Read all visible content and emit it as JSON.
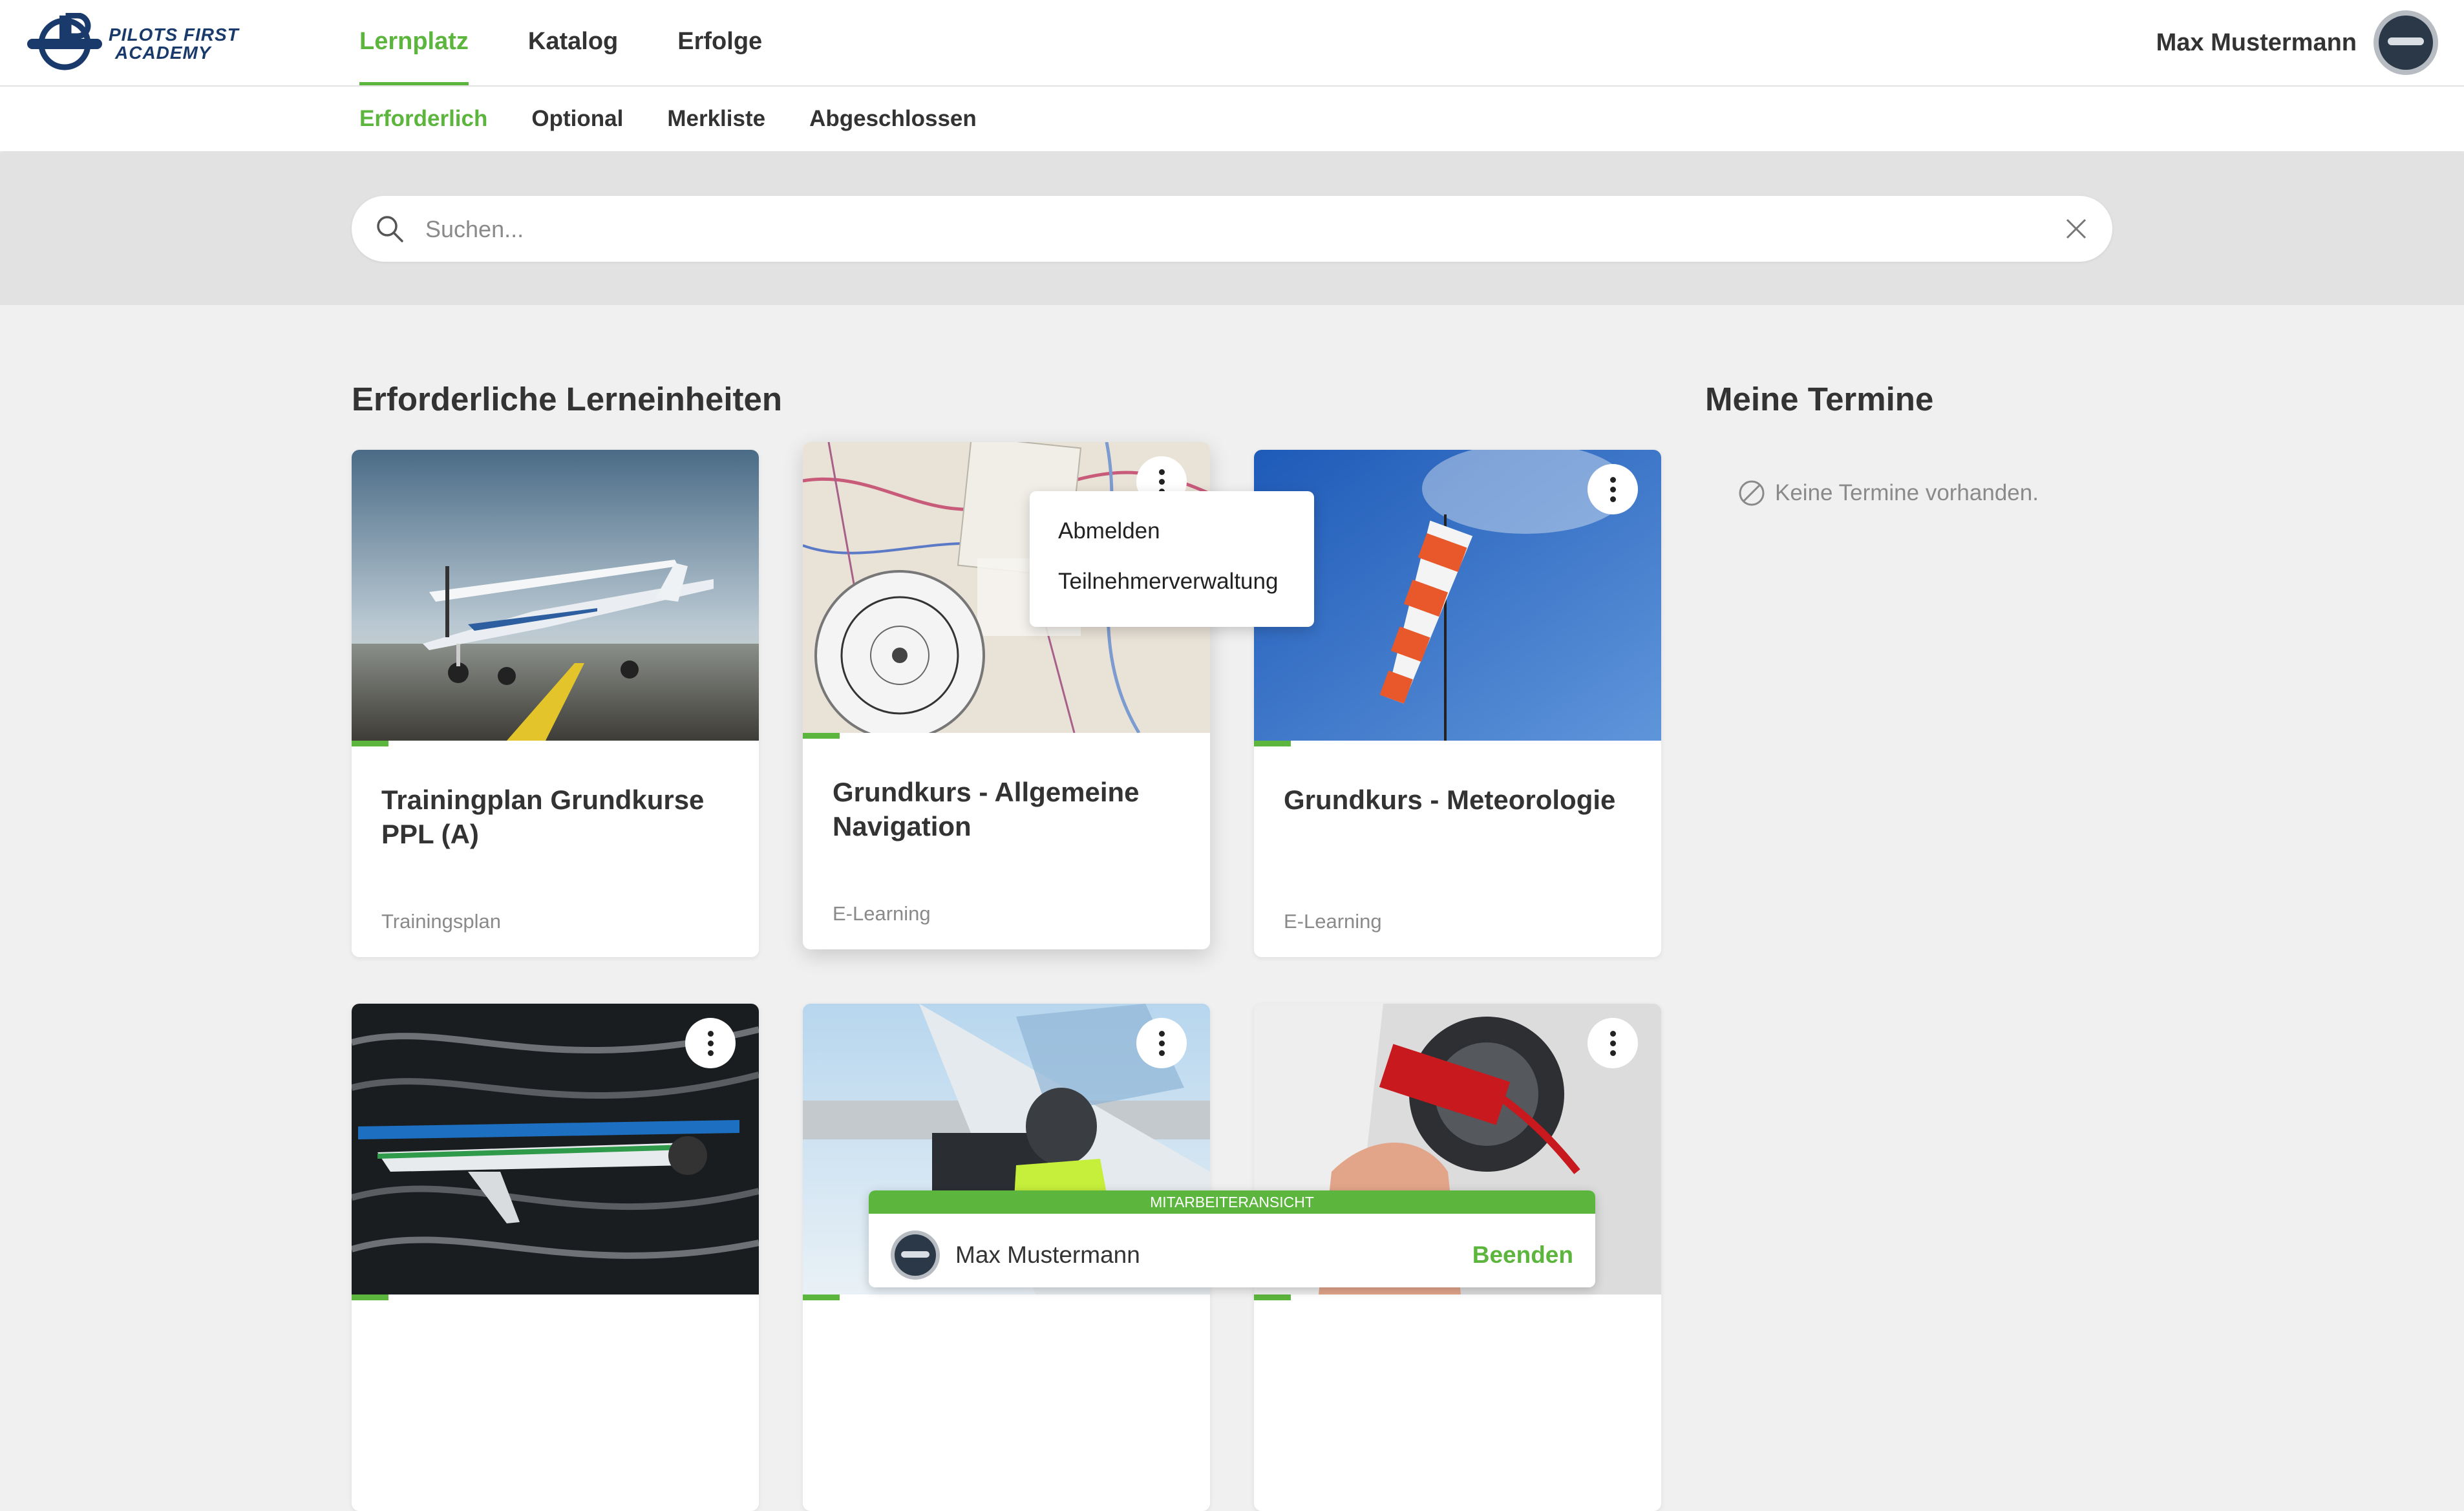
{
  "brand": {
    "name_line1": "PILOTS FIRST",
    "name_line2": "ACADEMY",
    "color": "#1a3a6b"
  },
  "colors": {
    "accent": "#5cb53c"
  },
  "header": {
    "nav": [
      {
        "label": "Lernplatz",
        "active": true
      },
      {
        "label": "Katalog",
        "active": false
      },
      {
        "label": "Erfolge",
        "active": false
      }
    ],
    "user_name": "Max Mustermann",
    "avatar_icon": "flugschule-avatar-icon"
  },
  "subnav": [
    {
      "label": "Erforderlich",
      "active": true
    },
    {
      "label": "Optional",
      "active": false
    },
    {
      "label": "Merkliste",
      "active": false
    },
    {
      "label": "Abgeschlossen",
      "active": false
    }
  ],
  "search": {
    "placeholder": "Suchen...",
    "value": ""
  },
  "main": {
    "section_title": "Erforderliche Lerneinheiten",
    "cards": [
      {
        "title": "Trainingplan Grundkurse PPL (A)",
        "type": "Trainingsplan",
        "image": "aircraft-on-runway",
        "progress": 0.09
      },
      {
        "title": "Grundkurs - Allgemeine Navigation",
        "type": "E-Learning",
        "image": "navigation-chart-compass",
        "progress": 0.09
      },
      {
        "title": "Grundkurs - Meteorologie",
        "type": "E-Learning",
        "image": "windsock-sky",
        "progress": 0.09
      },
      {
        "title": "",
        "type": "",
        "image": "aircraft-wind-tunnel",
        "progress": 0.09
      },
      {
        "title": "",
        "type": "",
        "image": "pilot-in-cockpit",
        "progress": 0.09
      },
      {
        "title": "",
        "type": "",
        "image": "remove-before-flight-tag",
        "progress": 0.09
      }
    ]
  },
  "context_menu": {
    "items": [
      "Abmelden",
      "Teilnehmerverwaltung"
    ]
  },
  "termine": {
    "title": "Meine Termine",
    "empty_text": "Keine Termine vorhanden."
  },
  "staff_view": {
    "banner": "MITARBEITERANSICHT",
    "user_name": "Max Mustermann",
    "end_label": "Beenden"
  }
}
